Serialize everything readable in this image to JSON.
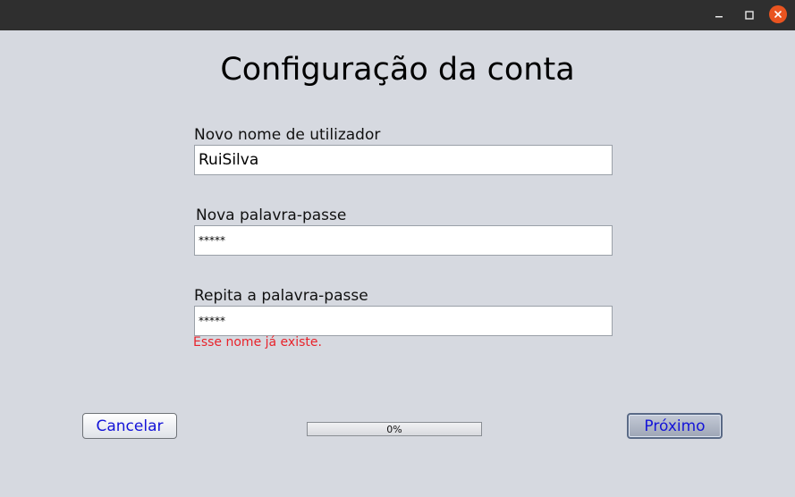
{
  "window": {
    "controls": {
      "minimize_glyph": "–",
      "maximize_glyph": "□",
      "close_glyph": "×"
    }
  },
  "page": {
    "title": "Configuração da conta"
  },
  "form": {
    "username": {
      "label": "Novo nome de utilizador",
      "value": "RuiSilva"
    },
    "password": {
      "label": "Nova palavra-passe",
      "value": "*****"
    },
    "repeat_password": {
      "label": "Repita a palavra-passe",
      "value": "*****"
    },
    "error_message": "Esse nome já existe."
  },
  "footer": {
    "cancel_label": "Cancelar",
    "next_label": "Próximo",
    "progress_text": "0%",
    "progress_value": 0
  },
  "colors": {
    "background": "#d6d9e0",
    "titlebar": "#2f2f2f",
    "close_button": "#e95420",
    "error_text": "#e8232b",
    "button_text": "#1414d8"
  }
}
